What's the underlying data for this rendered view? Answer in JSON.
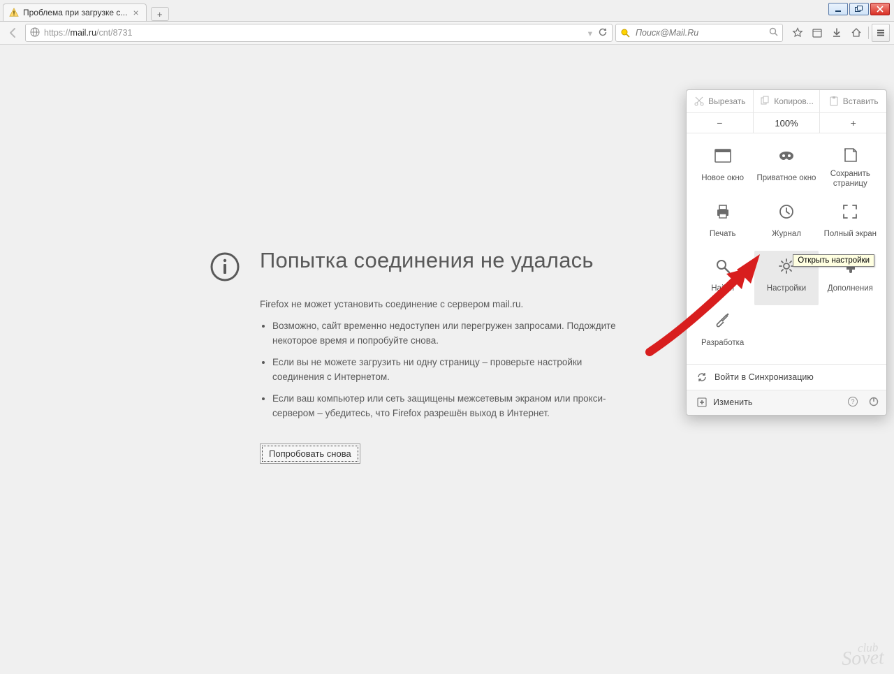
{
  "window": {
    "tab_title": "Проблема при загрузке с..."
  },
  "nav": {
    "url_prefix": "https://",
    "url_host": "mail.ru",
    "url_path": "/cnt/8731",
    "search_placeholder": "Поиск@Mail.Ru"
  },
  "error": {
    "title": "Попытка соединения не удалась",
    "subtitle": "Firefox не может установить соединение с сервером mail.ru.",
    "bullets": [
      "Возможно, сайт временно недоступен или перегружен запросами. Подождите некоторое время и попробуйте снова.",
      "Если вы не можете загрузить ни одну страницу – проверьте настройки соединения с Интернетом.",
      "Если ваш компьютер или сеть защищены межсетевым экраном или прокси-сервером – убедитесь, что Firefox разрешён выход в Интернет."
    ],
    "retry": "Попробовать снова"
  },
  "panel": {
    "edit": {
      "cut": "Вырезать",
      "copy": "Копиров...",
      "paste": "Вставить"
    },
    "zoom": {
      "value": "100%"
    },
    "grid": [
      {
        "id": "new-window",
        "label": "Новое окно"
      },
      {
        "id": "private",
        "label": "Приватное окно"
      },
      {
        "id": "save-page",
        "label": "Сохранить страницу"
      },
      {
        "id": "print",
        "label": "Печать"
      },
      {
        "id": "history",
        "label": "Журнал"
      },
      {
        "id": "fullscreen",
        "label": "Полный экран"
      },
      {
        "id": "find",
        "label": "Найти"
      },
      {
        "id": "settings",
        "label": "Настройки"
      },
      {
        "id": "addons",
        "label": "Дополнения"
      },
      {
        "id": "developer",
        "label": "Разработка"
      }
    ],
    "sync": "Войти в Синхронизацию",
    "customize": "Изменить",
    "tooltip": "Открыть настройки"
  },
  "watermark": {
    "top": "club",
    "bottom": "Sovet"
  }
}
